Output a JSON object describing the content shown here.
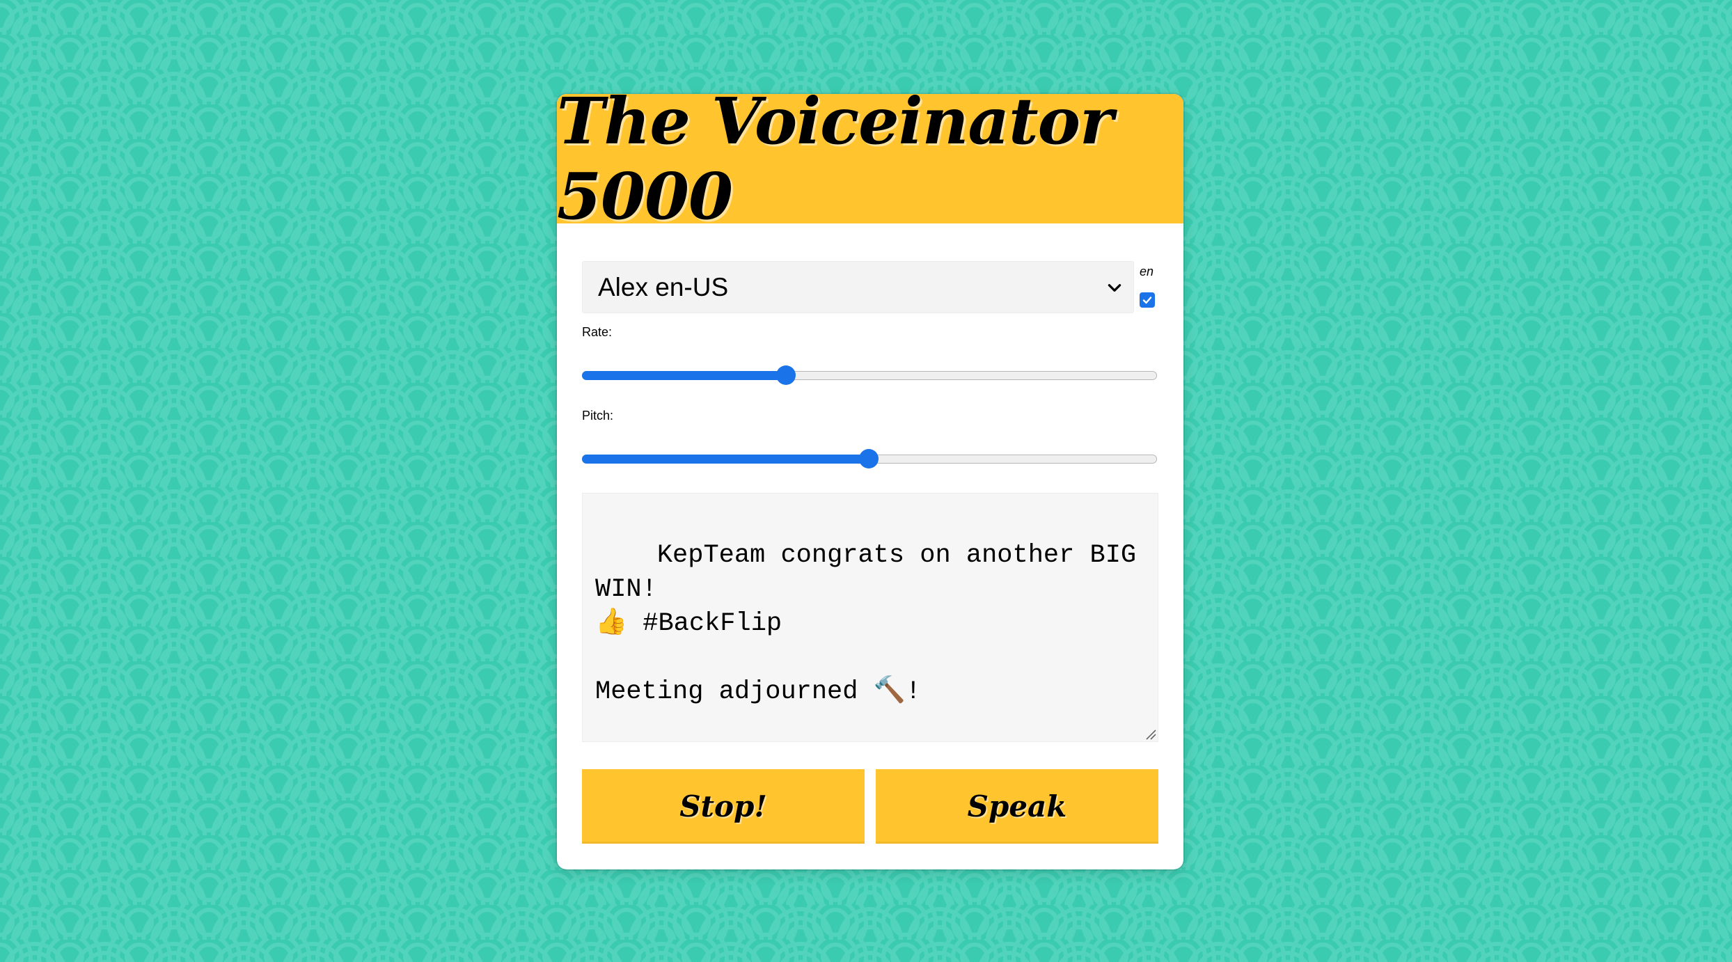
{
  "app": {
    "title": "The Voiceinator 5000"
  },
  "voice": {
    "selected": "Alex en-US",
    "filter_label": "en",
    "filter_checked": true
  },
  "rate": {
    "label": "Rate:",
    "fraction": 0.35
  },
  "pitch": {
    "label": "Pitch:",
    "fraction": 0.5
  },
  "message": {
    "text": "KepTeam congrats on another BIG WIN!\n👍 #BackFlip\n\nMeeting adjourned 🔨!"
  },
  "buttons": {
    "stop_label": "Stop!",
    "speak_label": "Speak"
  },
  "colors": {
    "background": "#3bcbb0",
    "accent": "#ffc42e",
    "slider": "#1a73e8"
  }
}
